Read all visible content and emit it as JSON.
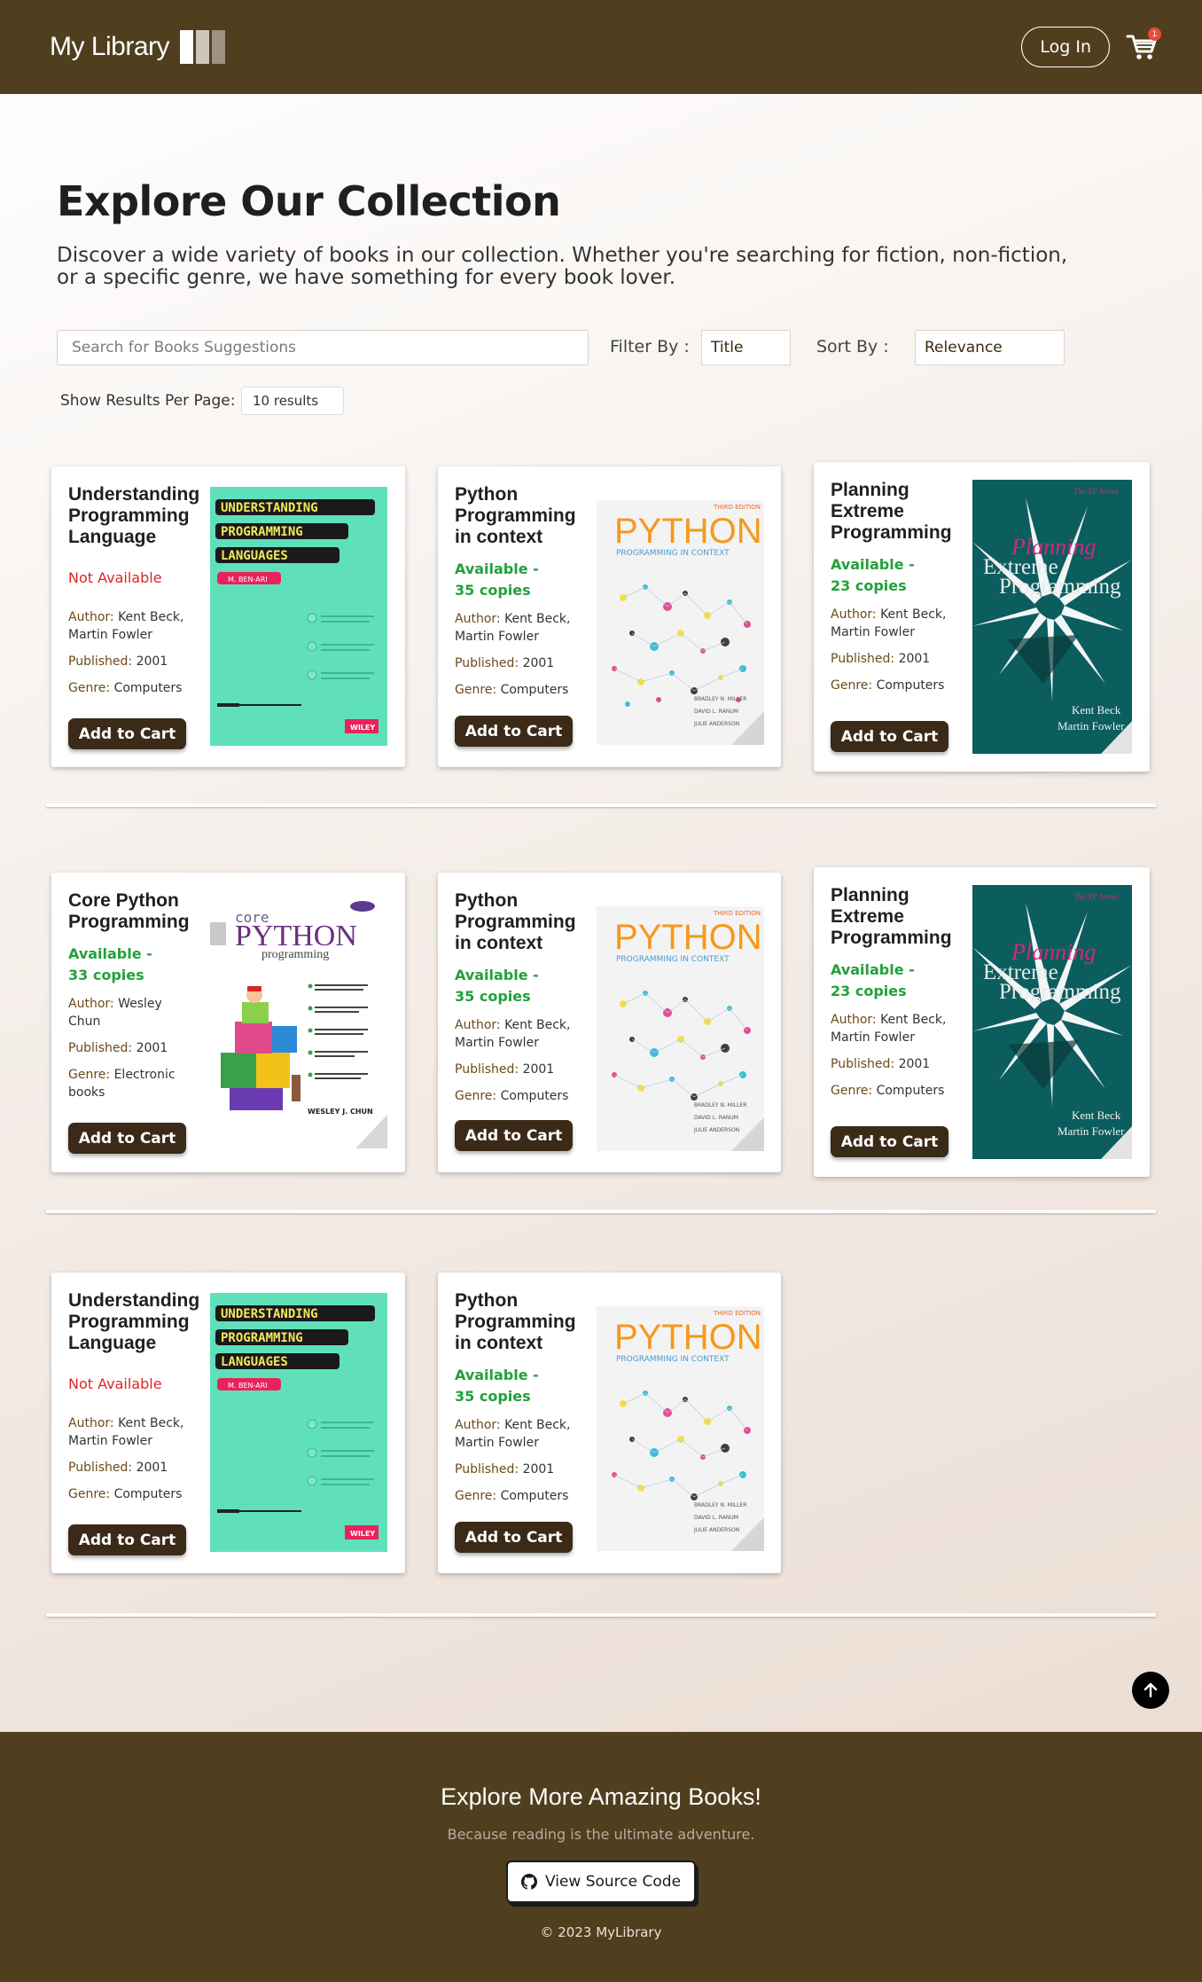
{
  "header": {
    "logo_text": "My Library",
    "login_label": "Log In",
    "cart_count": "1"
  },
  "main": {
    "title": "Explore Our Collection",
    "intro": "Discover a wide variety of books in our collection. Whether you're searching for fiction, non-fiction, or a specific genre, we have something for every book lover."
  },
  "controls": {
    "search_placeholder": "Search for Books Suggestions",
    "filter_label": "Filter By :",
    "filter_value": "Title",
    "sort_label": "Sort By :",
    "sort_value": "Relevance",
    "perpage_label": "Show Results Per Page:",
    "perpage_value": "10 results"
  },
  "labels": {
    "author": "Author:",
    "published": "Published:",
    "genre": "Genre:",
    "add_to_cart": "Add to Cart"
  },
  "books": [
    {
      "title": "Understanding Programming Language",
      "availability": "Not Available",
      "available": false,
      "author": "Kent Beck, Martin  Fowler",
      "published": "2001",
      "genre": "Computers",
      "cover": "understanding-programming-languages"
    },
    {
      "title": "Python Programming in context",
      "availability": "Available - 35 copies",
      "available": true,
      "author": "Kent Beck, Martin  Fowler",
      "published": "2001",
      "genre": "Computers",
      "cover": "python-programming-in-context"
    },
    {
      "title": "Planning Extreme Programming",
      "availability": "Available - 23 copies",
      "available": true,
      "author": "Kent Beck, Martin  Fowler",
      "published": "2001",
      "genre": "Computers",
      "cover": "planning-extreme-programming"
    },
    {
      "title": "Core Python Programming",
      "availability": "Available - 33 copies",
      "available": true,
      "author": "Wesley Chun",
      "published": "2001",
      "genre": "Electronic books",
      "cover": "core-python-programming"
    },
    {
      "title": "Python Programming in context",
      "availability": "Available - 35 copies",
      "available": true,
      "author": "Kent Beck, Martin  Fowler",
      "published": "2001",
      "genre": "Computers",
      "cover": "python-programming-in-context"
    },
    {
      "title": "Planning Extreme Programming",
      "availability": "Available - 23 copies",
      "available": true,
      "author": "Kent Beck, Martin  Fowler",
      "published": "2001",
      "genre": "Computers",
      "cover": "planning-extreme-programming"
    },
    {
      "title": "Understanding Programming Language",
      "availability": "Not Available",
      "available": false,
      "author": "Kent Beck, Martin  Fowler",
      "published": "2001",
      "genre": "Computers",
      "cover": "understanding-programming-languages"
    },
    {
      "title": "Python Programming in context",
      "availability": "Available - 35 copies",
      "available": true,
      "author": "Kent Beck, Martin  Fowler",
      "published": "2001",
      "genre": "Computers",
      "cover": "python-programming-in-context"
    }
  ],
  "covers": {
    "upl": {
      "lines": [
        "UNDERSTANDING",
        "PROGRAMMING",
        "LANGUAGES"
      ],
      "author": "M. BEN-ARI",
      "publisher": "WILEY"
    },
    "pic": {
      "edition": "THIRD EDITION",
      "word": "PYTHON",
      "subtitle": "PROGRAMMING IN CONTEXT",
      "authors": [
        "BRADLEY N. MILLER",
        "DAVID L. RANUM",
        "JULIE ANDERSON"
      ]
    },
    "pep": {
      "series": "The XP Series",
      "line1": "Planning",
      "line2": "Extreme",
      "line3": "Programming",
      "authors": [
        "Kent Beck",
        "Martin Fowler"
      ]
    },
    "cpp": {
      "core": "core",
      "python": "PYTHON",
      "programming": "programming",
      "author": "WESLEY J. CHUN"
    }
  },
  "footer": {
    "title": "Explore More Amazing Books!",
    "subtitle": "Because reading is the ultimate adventure.",
    "button_label": "View Source Code",
    "copyright": "© 2023 MyLibrary"
  },
  "colors": {
    "brand": "#4f3f1f",
    "button": "#3b2a17",
    "available": "#23a03a",
    "not_available": "#dc2626"
  },
  "icons": [
    "logo-bars-icon",
    "cart-icon",
    "arrow-up-icon",
    "github-icon"
  ]
}
